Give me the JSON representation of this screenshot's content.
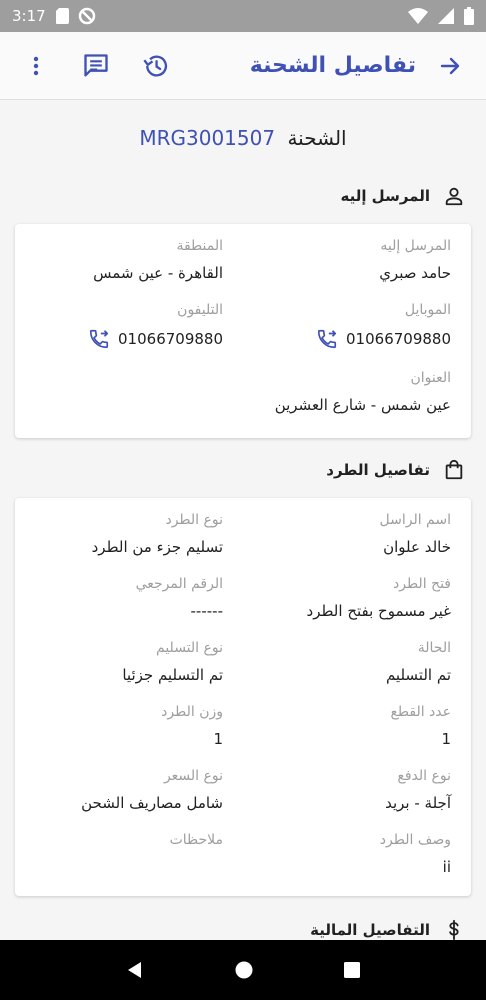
{
  "status_bar": {
    "time": "3:17"
  },
  "app_bar": {
    "title": "تفاصيل الشحنة"
  },
  "shipment": {
    "label": "الشحنة",
    "number": "MRG3001507"
  },
  "recipient_section": {
    "title": "المرسل إليه",
    "fields": {
      "recipient": {
        "label": "المرسل إليه",
        "value": "حامد صبري"
      },
      "region": {
        "label": "المنطقة",
        "value": "القاهرة - عين شمس"
      },
      "mobile": {
        "label": "الموبايل",
        "value": "01066709880"
      },
      "phone": {
        "label": "التليفون",
        "value": "01066709880"
      },
      "address": {
        "label": "العنوان",
        "value": "عين شمس - شارع العشرين"
      }
    }
  },
  "package_section": {
    "title": "تفاصيل الطرد",
    "fields": {
      "sender_name": {
        "label": "اسم الراسل",
        "value": "خالد علوان"
      },
      "package_type": {
        "label": "نوع الطرد",
        "value": "تسليم جزء من الطرد"
      },
      "open_package": {
        "label": "فتح الطرد",
        "value": "غير مسموح بفتح الطرد"
      },
      "reference": {
        "label": "الرقم المرجعي",
        "value": "------"
      },
      "status": {
        "label": "الحالة",
        "value": "تم التسليم"
      },
      "delivery_type": {
        "label": "نوع التسليم",
        "value": "تم التسليم جزئيا"
      },
      "pieces": {
        "label": "عدد القطع",
        "value": "1"
      },
      "weight": {
        "label": "وزن الطرد",
        "value": "1"
      },
      "payment_type": {
        "label": "نوع الدفع",
        "value": "آجلة - بريد"
      },
      "price_type": {
        "label": "نوع السعر",
        "value": "شامل مصاريف الشحن"
      },
      "description": {
        "label": "وصف الطرد",
        "value": "ii"
      },
      "notes": {
        "label": "ملاحظات",
        "value": ""
      }
    }
  },
  "financial_section": {
    "title": "التفاصيل المالية"
  },
  "colors": {
    "accent": "#3f51b5",
    "label_gray": "#9e9e9e"
  }
}
